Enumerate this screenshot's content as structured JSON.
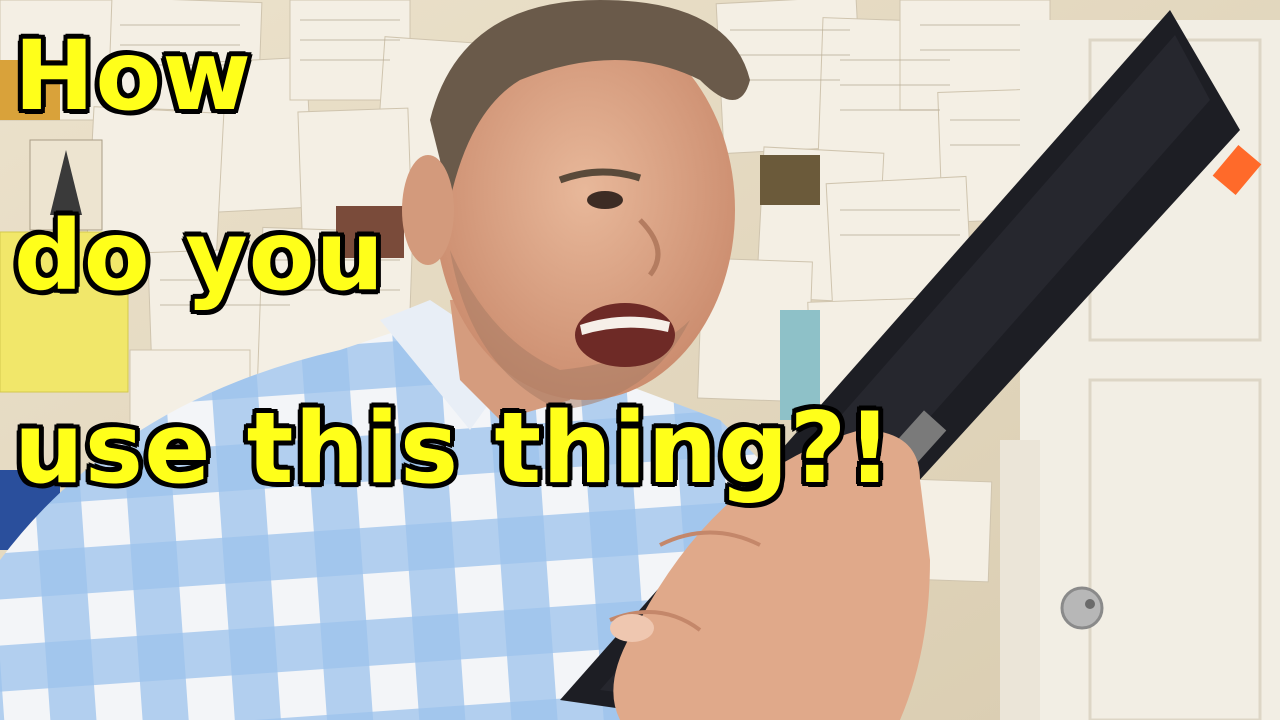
{
  "caption": {
    "line_1": "How",
    "line_2": "do you",
    "line_3": "use this thing?!"
  },
  "colors": {
    "caption_fill": "#ffff1a",
    "caption_outline": "#000000",
    "wall": "#e8dcc4",
    "paper": "#f4efe4",
    "door": "#f2eee4",
    "shirt_blue": "#8fb8e6",
    "shirt_white": "#f3f5f8",
    "keyboard": "#1d1e24",
    "skin": "#e0a98a",
    "hair": "#6a5a4a"
  }
}
